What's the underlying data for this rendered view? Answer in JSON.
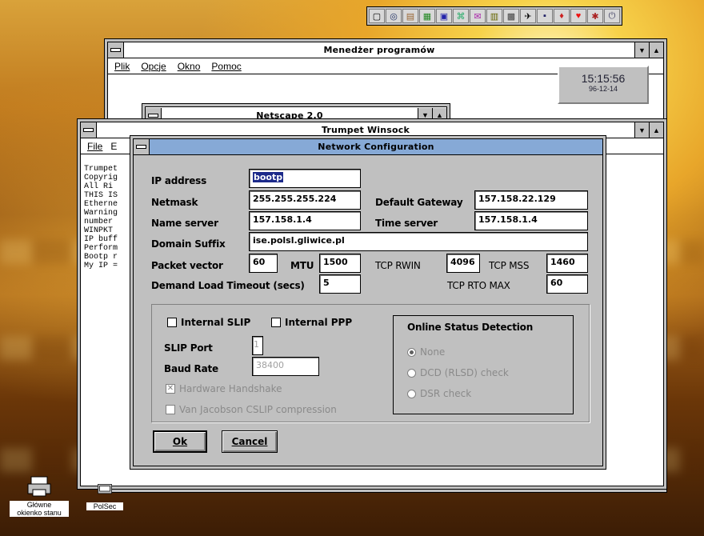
{
  "toolbar_icons": [
    "doc-icon",
    "globe-icon",
    "folder-icon",
    "chart-icon",
    "monitor-icon",
    "network-icon",
    "mail-icon",
    "notes-icon",
    "calc-icon",
    "plane-icon",
    "disk-icon",
    "balloon-icon",
    "heart-icon",
    "paint-icon",
    "power-icon"
  ],
  "program_manager": {
    "title": "Menedżer programów",
    "menu": [
      "Plik",
      "Opcje",
      "Okno",
      "Pomoc"
    ]
  },
  "clock": {
    "time": "15:15:56",
    "date": "96-12-14"
  },
  "netscape": {
    "title": "Netscape 2.0"
  },
  "trumpet": {
    "title": "Trumpet Winsock",
    "menu": [
      "File",
      "E"
    ],
    "lines": [
      "Trumpet",
      "Copyrig",
      "All Ri",
      "THIS IS",
      "Etherne",
      "Warning",
      "number",
      "WINPKT",
      "IP buff",
      "Perform",
      "Bootp r",
      "My IP ="
    ]
  },
  "dialog": {
    "title": "Network Configuration",
    "ip_address_label": "IP address",
    "ip_address": "bootp",
    "netmask_label": "Netmask",
    "netmask": "255.255.255.224",
    "gateway_label": "Default Gateway",
    "gateway": "157.158.22.129",
    "name_server_label": "Name server",
    "name_server": "157.158.1.4",
    "time_server_label": "Time server",
    "time_server": "157.158.1.4",
    "domain_label": "Domain Suffix",
    "domain": "ise.polsl.gliwice.pl",
    "packet_vector_label": "Packet vector",
    "packet_vector": "60",
    "mtu_label": "MTU",
    "mtu": "1500",
    "tcp_rwin_label": "TCP RWIN",
    "tcp_rwin": "4096",
    "tcp_mss_label": "TCP MSS",
    "tcp_mss": "1460",
    "demand_label": "Demand Load Timeout (secs)",
    "demand": "5",
    "rto_label": "TCP RTO MAX",
    "rto": "60",
    "internal_slip": "Internal SLIP",
    "internal_ppp": "Internal PPP",
    "slip_port_label": "SLIP Port",
    "slip_port": "1",
    "baud_label": "Baud Rate",
    "baud": "38400",
    "hw_handshake": "Hardware Handshake",
    "vj": "Van Jacobson CSLIP compression",
    "online_title": "Online Status Detection",
    "radio_none": "None",
    "radio_dcd": "DCD (RLSD) check",
    "radio_dsr": "DSR check",
    "ok": "Ok",
    "cancel": "Cancel"
  },
  "desktop_icons": [
    {
      "label_1": "Główne",
      "label_2": "okienko stanu"
    },
    {
      "label_1": "PolSec"
    }
  ]
}
